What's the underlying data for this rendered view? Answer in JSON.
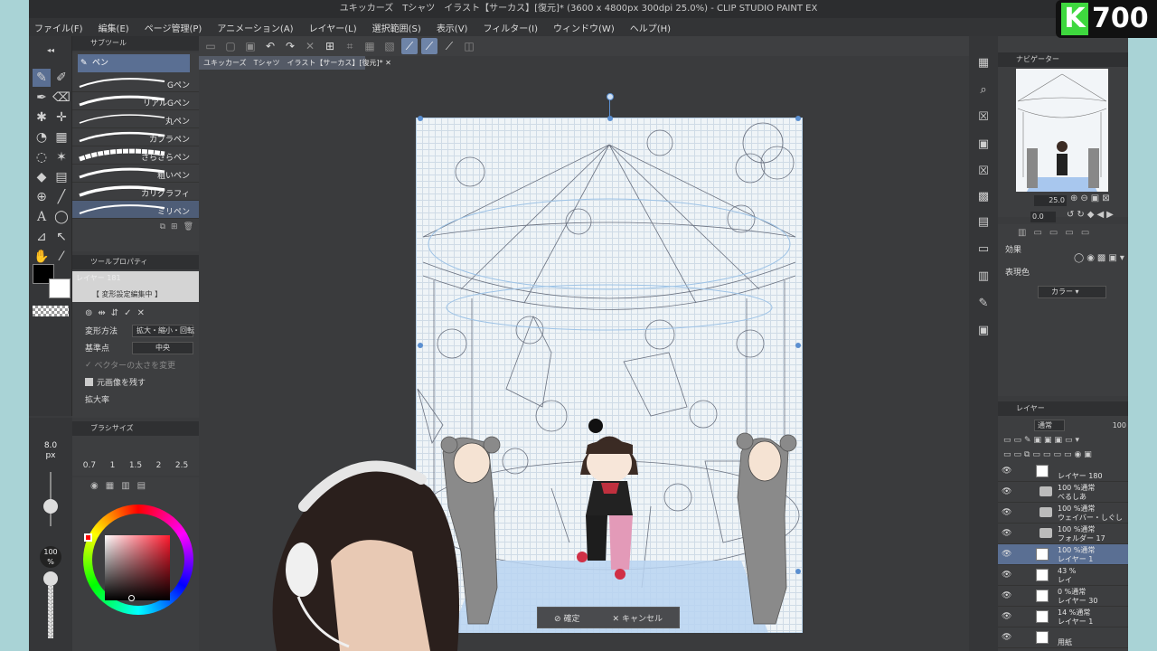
{
  "title": "ユキッカーズ　Tシャツ　イラスト【サーカス】[復元]* (3600 x 4800px 300dpi 25.0%) - CLIP STUDIO PAINT EX",
  "menu": [
    "ファイル(F)",
    "編集(E)",
    "ページ管理(P)",
    "アニメーション(A)",
    "レイヤー(L)",
    "選択範囲(S)",
    "表示(V)",
    "フィルター(I)",
    "ウィンドウ(W)",
    "ヘルプ(H)"
  ],
  "doc_tab": "ユキッカーズ　Tシャツ　イラスト【サーカス】[復元]*",
  "subtool": {
    "header": "サブツール",
    "current": "ペン",
    "brushes": [
      "Gペン",
      "リアルGペン",
      "丸ペン",
      "カブラペン",
      "さらさらペン",
      "粗いペン",
      "カリグラフィ",
      "ミリペン"
    ]
  },
  "toolprop": {
    "header": "ツールプロパティ",
    "layer_name": "レイヤー 181",
    "mode_label": "【 変形設定編集中 】",
    "transform_method_label": "変形方法",
    "transform_method_value": "拡大・縮小・回転",
    "reference_point_label": "基準点",
    "reference_point_value": "中央",
    "vector_width_label": "ベクターの太さを変更",
    "keep_original_label": "元画像を残す",
    "scale_label": "拡大率"
  },
  "brushsize": {
    "header": "ブラシサイズ",
    "size_value": "8.0",
    "size_unit": "px",
    "presets": [
      "0.7",
      "1",
      "1.5",
      "2",
      "2.5"
    ]
  },
  "opacity": {
    "value": "100",
    "unit": "%"
  },
  "colors": {
    "main": "#000000",
    "sub": "#ffffff",
    "accent": "#6e84a8"
  },
  "confirm": {
    "ok": "確定",
    "cancel": "キャンセル"
  },
  "navigator": {
    "header": "ナビゲーター",
    "zoom": "25.0",
    "rotation": "0.0"
  },
  "effects": {
    "header": "効果",
    "color_label": "表現色",
    "color_value": "カラー"
  },
  "layers": {
    "header": "レイヤー",
    "blend": "通常",
    "opacity": "100",
    "rows": [
      {
        "line1": "",
        "line2": "レイヤー 180",
        "kind": "layer"
      },
      {
        "line1": "100 %通常",
        "line2": "べるしあ",
        "kind": "folder"
      },
      {
        "line1": "100 %通常",
        "line2": "ウェイバー・しぐし",
        "kind": "folder"
      },
      {
        "line1": "100 %通常",
        "line2": "フォルダー 17",
        "kind": "folder"
      },
      {
        "line1": "100 %通常",
        "line2": "レイヤー 1",
        "kind": "selected"
      },
      {
        "line1": "43 %",
        "line2": "レイ",
        "kind": "layer"
      },
      {
        "line1": "0 %通常",
        "line2": "レイヤー 30",
        "kind": "layer"
      },
      {
        "line1": "14 %通常",
        "line2": "レイヤー 1",
        "kind": "layer"
      },
      {
        "line1": "",
        "line2": "用紙",
        "kind": "paper"
      }
    ]
  },
  "score_badge": {
    "letter": "K",
    "value": "700"
  },
  "icons": [
    "pen-icon",
    "eraser-icon",
    "brush-icon",
    "fill-icon",
    "text-icon",
    "move-icon",
    "eyedropper-icon",
    "lasso-icon",
    "undo-icon",
    "redo-icon",
    "eye-icon",
    "folder-icon"
  ]
}
